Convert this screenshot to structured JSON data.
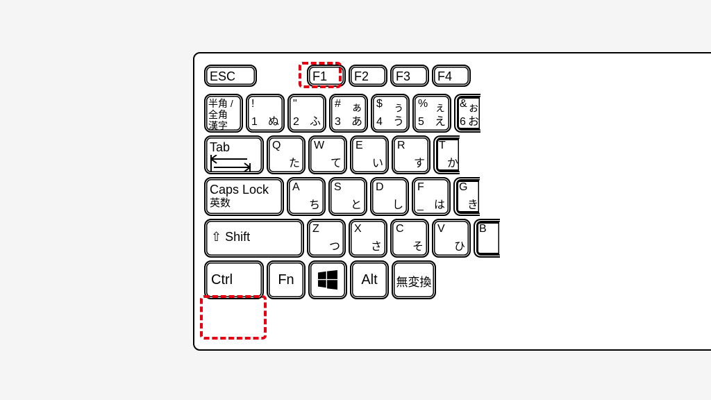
{
  "frow": {
    "esc": "ESC",
    "f1": "F1",
    "f2": "F2",
    "f3": "F3",
    "f4": "F4"
  },
  "zenkaku": {
    "l1": "半角 /",
    "l2": "全角",
    "l3": "漢字"
  },
  "n1": {
    "tl": "!",
    "bl": "1",
    "br": "ぬ"
  },
  "n2": {
    "tl": "\"",
    "bl": "2",
    "br": "ふ"
  },
  "n3": {
    "tl": "#",
    "tr": "ぁ",
    "bl": "3",
    "br": "あ"
  },
  "n4": {
    "tl": "$",
    "tr": "ぅ",
    "bl": "4",
    "br": "う"
  },
  "n5": {
    "tl": "%",
    "tr": "ぇ",
    "bl": "5",
    "br": "え"
  },
  "n6": {
    "tl": "&",
    "tr": "ぉ",
    "bl": "6",
    "br": "お"
  },
  "tab": {
    "label": "Tab"
  },
  "q": {
    "tl": "Q",
    "br": "た"
  },
  "w": {
    "tl": "W",
    "br": "て"
  },
  "e": {
    "tl": "E",
    "br": "い"
  },
  "r": {
    "tl": "R",
    "br": "す"
  },
  "t": {
    "tl": "T",
    "br": "か"
  },
  "caps": {
    "l1": "Caps Lock",
    "l2": "英数"
  },
  "a": {
    "tl": "A",
    "br": "ち"
  },
  "s": {
    "tl": "S",
    "br": "と"
  },
  "d": {
    "tl": "D",
    "br": "し"
  },
  "f": {
    "tl": "F",
    "bl": "_",
    "br": "は"
  },
  "g": {
    "tl": "G",
    "br": "き"
  },
  "shift": {
    "label": "Shift"
  },
  "z": {
    "tl": "Z",
    "br": "つ"
  },
  "x": {
    "tl": "X",
    "br": "さ"
  },
  "c": {
    "tl": "C",
    "br": "そ"
  },
  "v": {
    "tl": "V",
    "br": "ひ"
  },
  "b": {
    "tl": "B"
  },
  "bottom": {
    "ctrl": "Ctrl",
    "fn": "Fn",
    "alt": "Alt",
    "muhenkan": "無変換"
  }
}
